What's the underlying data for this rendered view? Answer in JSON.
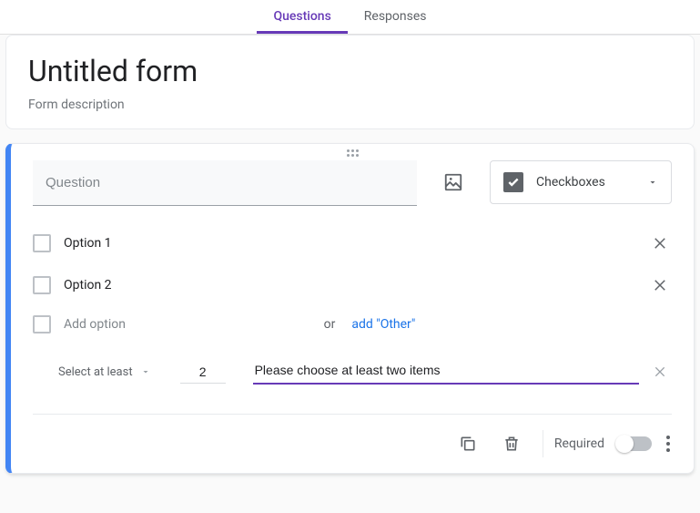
{
  "tabs": {
    "questions": "Questions",
    "responses": "Responses"
  },
  "header": {
    "title": "Untitled form",
    "description": "Form description"
  },
  "question": {
    "placeholder": "Question",
    "type_label": "Checkboxes",
    "options": [
      {
        "label": "Option 1"
      },
      {
        "label": "Option 2"
      }
    ],
    "add_option": "Add option",
    "or": "or",
    "add_other": "add \"Other\"",
    "validation": {
      "rule": "Select at least",
      "number": "2",
      "message": "Please choose at least two items"
    },
    "footer": {
      "required_label": "Required",
      "required_on": false
    }
  }
}
